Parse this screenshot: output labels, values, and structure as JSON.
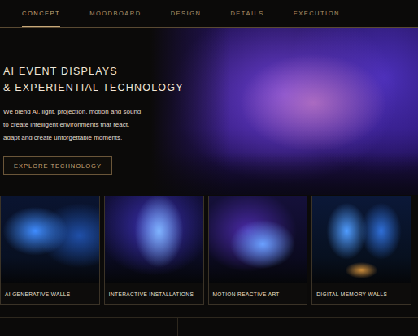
{
  "nav": {
    "items": [
      {
        "label": "CONCEPT",
        "selected": true
      },
      {
        "label": "MOODBOARD",
        "selected": false
      },
      {
        "label": "DESIGN",
        "selected": false
      },
      {
        "label": "DETAILS",
        "selected": false
      },
      {
        "label": "EXECUTION",
        "selected": false
      }
    ]
  },
  "hero": {
    "title_lines": [
      "AI EVENT DISPLAYS",
      "& EXPERIENTIAL TECHNOLOGY"
    ],
    "text_lines": [
      "We blend AI, light, projection, motion and sound",
      "to create intelligent environments that react,",
      "adapt and create unforgettable moments."
    ],
    "button": "EXPLORE TECHNOLOGY"
  },
  "cards": [
    {
      "label": "AI GENERATIVE WALLS"
    },
    {
      "label": "INTERACTIVE INSTALLATIONS"
    },
    {
      "label": "MOTION REACTIVE ART"
    },
    {
      "label": "DIGITAL MEMORY WALLS"
    }
  ]
}
